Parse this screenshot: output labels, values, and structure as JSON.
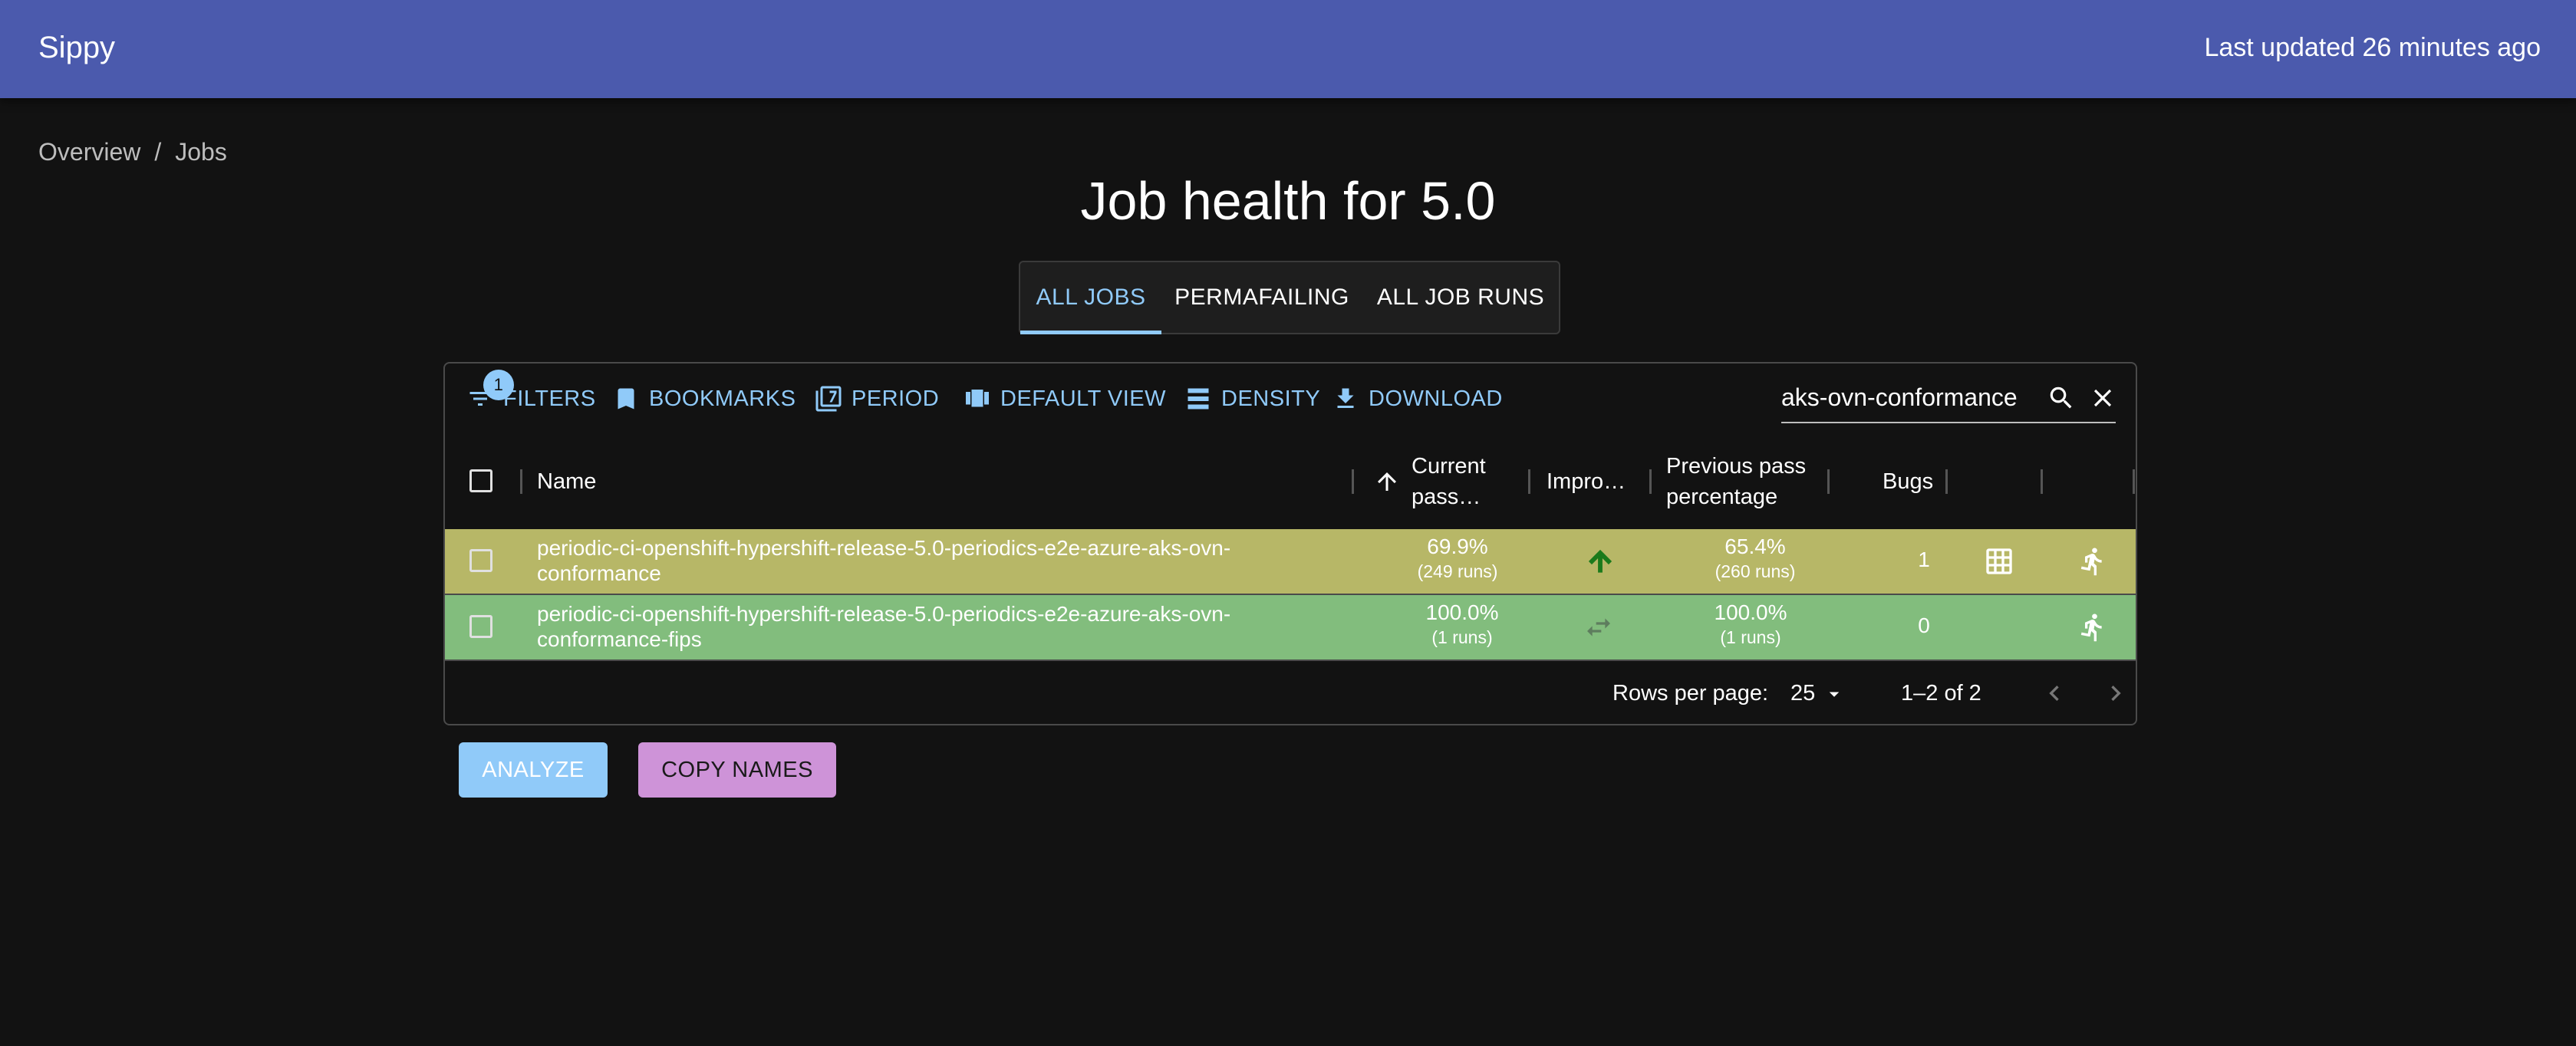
{
  "app": {
    "title": "Sippy",
    "last_updated": "Last updated 26 minutes ago"
  },
  "breadcrumb": [
    {
      "label": "Overview"
    },
    {
      "label": "Jobs"
    }
  ],
  "breadcrumb_separator": "/",
  "page_title": "Job health for 5.0",
  "tabs": [
    {
      "label": "ALL JOBS",
      "active": true
    },
    {
      "label": "PERMAFAILING",
      "active": false
    },
    {
      "label": "ALL JOB RUNS",
      "active": false
    }
  ],
  "toolbar": {
    "filters_label": "FILTERS",
    "filters_badge": "1",
    "bookmarks_label": "BOOKMARKS",
    "period_label": "PERIOD",
    "default_view_label": "DEFAULT VIEW",
    "density_label": "DENSITY",
    "download_label": "DOWNLOAD",
    "search_value": "aks-ovn-conformance"
  },
  "columns": {
    "name": "Name",
    "current_pass_line1": "Current",
    "current_pass_line2": "pass…",
    "improvement": "Impro…",
    "previous_pass_line1": "Previous pass",
    "previous_pass_line2": "percentage",
    "bugs": "Bugs"
  },
  "rows": [
    {
      "name_line1": "periodic-ci-openshift-hypershift-release-5.0-periodics-e2e-azure-aks-ovn-",
      "name_line2": "conformance",
      "current_pass": "69.9%",
      "current_runs": "(249 runs)",
      "improvement_icon": "arrow-up-icon",
      "previous_pass": "65.4%",
      "previous_runs": "(260 runs)",
      "bugs": "1",
      "row_color": "#b7b767"
    },
    {
      "name_line1": "periodic-ci-openshift-hypershift-release-5.0-periodics-e2e-azure-aks-ovn-",
      "name_line2": "conformance-fips",
      "current_pass": "100.0%",
      "current_runs": "(1 runs)",
      "improvement_icon": "swap-icon",
      "previous_pass": "100.0%",
      "previous_runs": "(1 runs)",
      "bugs": "0",
      "row_color": "#82bd7d"
    }
  ],
  "pagination": {
    "rows_per_page_label": "Rows per page:",
    "rows_per_page": "25",
    "range": "1–2 of 2"
  },
  "actions": {
    "analyze_label": "ANALYZE",
    "copy_names_label": "COPY NAMES"
  },
  "colors": {
    "appbar": "#4b5aad",
    "accent": "#90caf9",
    "copy_button": "#ce93d8",
    "improve_up": "#1b7a1b"
  }
}
